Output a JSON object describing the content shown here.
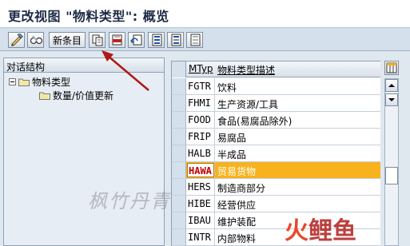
{
  "header": {
    "title": "更改视图 \"物料类型\": 概览"
  },
  "toolbar": {
    "new_entries_label": "新条目"
  },
  "tree": {
    "header": "对话结构",
    "root_label": "物料类型",
    "child_label": "数量/价值更新"
  },
  "table": {
    "columns": [
      "MTyp",
      "物料类型描述"
    ],
    "rows": [
      {
        "code": "FGTR",
        "desc": "饮料"
      },
      {
        "code": "FHMI",
        "desc": "生产资源/工具"
      },
      {
        "code": "FOOD",
        "desc": "食品(易腐品除外)"
      },
      {
        "code": "FRIP",
        "desc": "易腐品"
      },
      {
        "code": "HALB",
        "desc": "半成品"
      },
      {
        "code": "HAWA",
        "desc": "贸易货物"
      },
      {
        "code": "HERS",
        "desc": "制造商部分"
      },
      {
        "code": "HIBE",
        "desc": "经营供应"
      },
      {
        "code": "IBAU",
        "desc": "维护装配"
      },
      {
        "code": "INTR",
        "desc": "内部物料"
      }
    ],
    "selected_code": "HAWA"
  },
  "watermarks": {
    "left": "枫竹丹青",
    "right_a": "火",
    "right_b": "鲤鱼"
  },
  "colors": {
    "highlight": "#f7b21d",
    "selected_code_text": "#c00000",
    "arrow": "#b01818"
  },
  "icons": [
    "display-change-icon",
    "glasses-icon",
    "copy-icon",
    "delete-icon",
    "undo-icon",
    "select-all-icon",
    "select-block-icon",
    "deselect-all-icon",
    "column-settings-icon",
    "folder-icon",
    "scroll-up-icon",
    "scroll-down-icon"
  ]
}
